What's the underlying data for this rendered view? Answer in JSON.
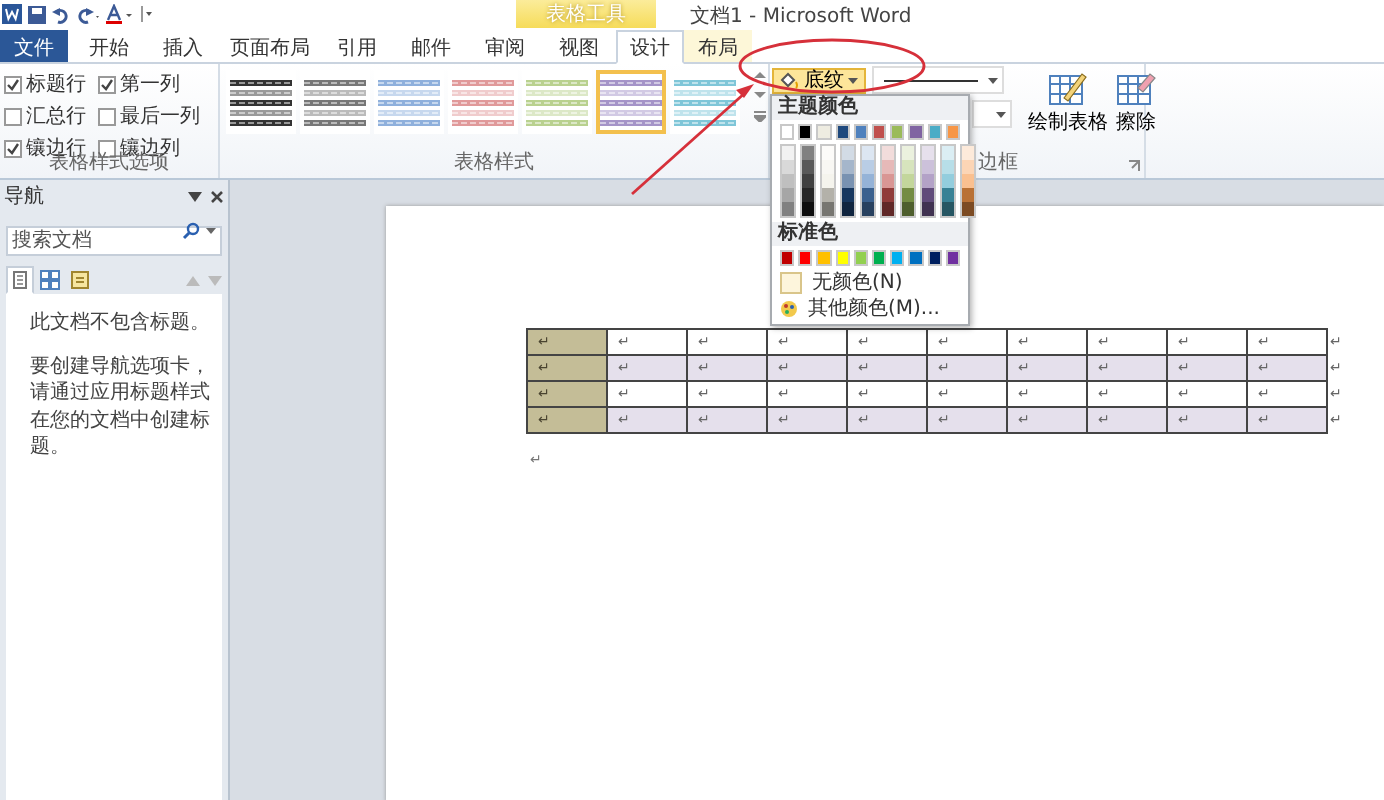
{
  "window": {
    "title": "文档1 - Microsoft Word",
    "context_tab_group": "表格工具"
  },
  "tabs": [
    {
      "label": "文件",
      "kind": "file",
      "selected": false
    },
    {
      "label": "开始",
      "kind": "tab",
      "selected": false
    },
    {
      "label": "插入",
      "kind": "tab",
      "selected": false
    },
    {
      "label": "页面布局",
      "kind": "tab",
      "selected": false
    },
    {
      "label": "引用",
      "kind": "tab",
      "selected": false
    },
    {
      "label": "邮件",
      "kind": "tab",
      "selected": false
    },
    {
      "label": "审阅",
      "kind": "tab",
      "selected": false
    },
    {
      "label": "视图",
      "kind": "tab",
      "selected": false
    },
    {
      "label": "设计",
      "kind": "context",
      "selected": true
    },
    {
      "label": "布局",
      "kind": "context",
      "selected": false
    }
  ],
  "style_options": {
    "label": "表格样式选项",
    "items": [
      {
        "label": "标题行",
        "checked": true
      },
      {
        "label": "第一列",
        "checked": true
      },
      {
        "label": "汇总行",
        "checked": false
      },
      {
        "label": "最后一列",
        "checked": false
      },
      {
        "label": "镶边行",
        "checked": true
      },
      {
        "label": "镶边列",
        "checked": false
      }
    ]
  },
  "table_styles": {
    "label": "表格样式",
    "items": [
      {
        "color": "#333333",
        "selected": false
      },
      {
        "color": "#777777",
        "selected": false
      },
      {
        "color": "#8fb0dc",
        "selected": false
      },
      {
        "color": "#e0999a",
        "selected": false
      },
      {
        "color": "#b9d18f",
        "selected": false
      },
      {
        "color": "#a594c8",
        "selected": true
      },
      {
        "color": "#7fc6d8",
        "selected": false
      }
    ]
  },
  "shading": {
    "label": "底纹",
    "expanded": true
  },
  "borders_group": {
    "label": "边框"
  },
  "draw_buttons": [
    {
      "label": "绘制表格"
    },
    {
      "label": "擦除"
    }
  ],
  "color_menu": {
    "theme_label": "主题颜色",
    "theme_colors": [
      {
        "color": "#ffffff"
      },
      {
        "color": "#000000"
      },
      {
        "color": "#eeece1"
      },
      {
        "color": "#1f497d"
      },
      {
        "color": "#4f81bd"
      },
      {
        "color": "#c0504d"
      },
      {
        "color": "#9bbb59"
      },
      {
        "color": "#8064a2"
      },
      {
        "color": "#4bacc6"
      },
      {
        "color": "#f79646"
      }
    ],
    "standard_label": "标准色",
    "standard_colors": [
      {
        "color": "#c00000"
      },
      {
        "color": "#ff0000"
      },
      {
        "color": "#ffc000"
      },
      {
        "color": "#ffff00"
      },
      {
        "color": "#92d050"
      },
      {
        "color": "#00b050"
      },
      {
        "color": "#00b0f0"
      },
      {
        "color": "#0070c0"
      },
      {
        "color": "#002060"
      },
      {
        "color": "#7030a0"
      }
    ],
    "no_color": "无颜色(N)",
    "more_colors": "其他颜色(M)..."
  },
  "navigation": {
    "title": "导航",
    "search": {
      "placeholder": "搜索文档"
    },
    "view_tabs": [
      {
        "selected": true
      },
      {
        "selected": false
      },
      {
        "selected": false
      }
    ],
    "message": "此文档不包含标题。",
    "hint": "要创建导航选项卡，请通过应用标题样式在您的文档中创建标题。"
  },
  "document": {
    "table": {
      "rows": [
        {
          "shaded": false,
          "cells": [
            "↵",
            "↵",
            "↵",
            "↵",
            "↵",
            "↵",
            "↵",
            "↵",
            "↵",
            "↵"
          ],
          "end": "↵"
        },
        {
          "shaded": true,
          "cells": [
            "↵",
            "↵",
            "↵",
            "↵",
            "↵",
            "↵",
            "↵",
            "↵",
            "↵",
            "↵"
          ],
          "end": "↵"
        },
        {
          "shaded": false,
          "cells": [
            "↵",
            "↵",
            "↵",
            "↵",
            "↵",
            "↵",
            "↵",
            "↵",
            "↵",
            "↵"
          ],
          "end": "↵"
        },
        {
          "shaded": true,
          "cells": [
            "↵",
            "↵",
            "↵",
            "↵",
            "↵",
            "↵",
            "↵",
            "↵",
            "↵",
            "↵"
          ],
          "end": "↵"
        }
      ]
    },
    "paragraph_mark": "↵"
  }
}
